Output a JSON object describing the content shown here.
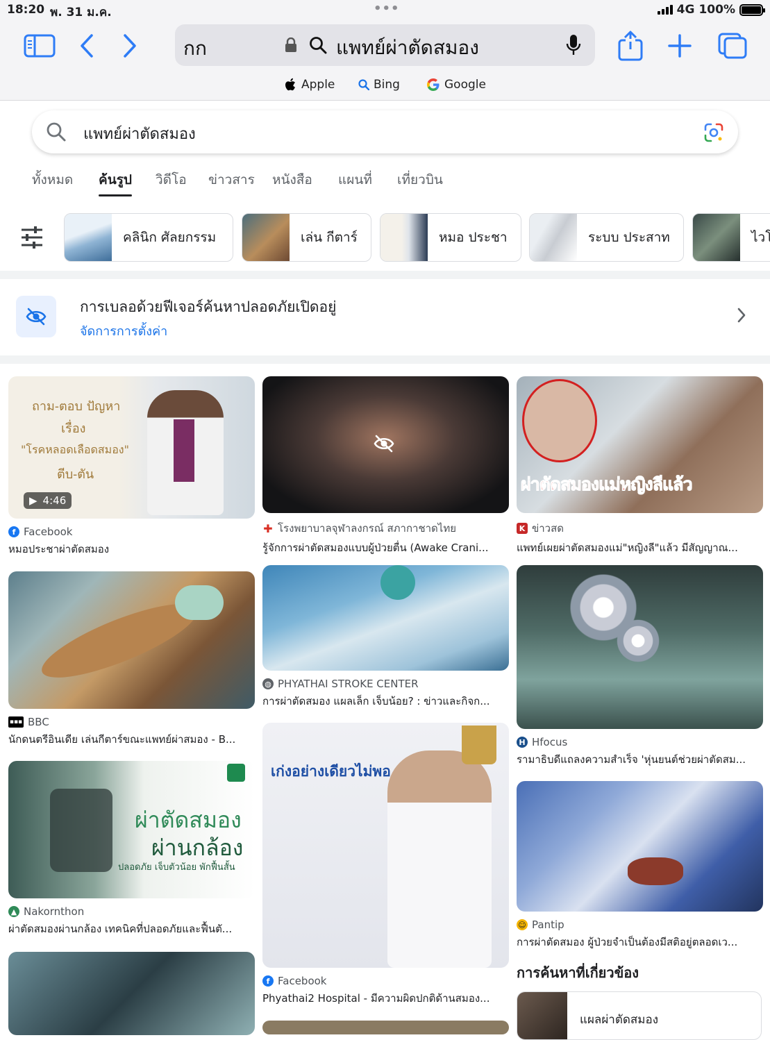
{
  "status_bar": {
    "time": "18:20",
    "date": "พ. 31 ม.ค.",
    "network": "4G",
    "battery": "100%"
  },
  "toolbar": {
    "text_size": "กก",
    "url": "แพทย์ผ่าตัดสมอง"
  },
  "bookmarks": [
    {
      "label": "Apple"
    },
    {
      "label": "Bing"
    },
    {
      "label": "Google"
    }
  ],
  "search": {
    "query": "แพทย์ผ่าตัดสมอง"
  },
  "tabs": [
    {
      "label": "ทั้งหมด"
    },
    {
      "label": "ค้นรูป",
      "active": true
    },
    {
      "label": "วิดีโอ"
    },
    {
      "label": "ข่าวสาร"
    },
    {
      "label": "หนังสือ"
    },
    {
      "label": "แผนที่"
    },
    {
      "label": "เที่ยวบิน"
    }
  ],
  "chips": [
    {
      "label": "คลินิก ศัลยกรรม"
    },
    {
      "label": "เล่น กีตาร์"
    },
    {
      "label": "หมอ ประชา"
    },
    {
      "label": "ระบบ ประสาท"
    },
    {
      "label": "ไวโอ"
    }
  ],
  "safe_search": {
    "title": "การเบลอด้วยฟีเจอร์ค้นหาปลอดภัยเปิดอยู่",
    "link": "จัดการการตั้งค่า"
  },
  "results": {
    "col1": [
      {
        "source": "Facebook",
        "title": "หมอประชาผ่าตัดสมอง",
        "duration": "4:46",
        "overlay": [
          "ถาม-ตอบ ปัญหา",
          "เรื่อง",
          "\"โรคหลอดเลือดสมอง\"",
          "ตีบ-ตัน"
        ]
      },
      {
        "source": "BBC",
        "title": "นักดนตรีอินเดีย เล่นกีตาร์ขณะแพทย์ผ่าสมอง - B..."
      },
      {
        "source": "Nakornthon",
        "title": "ผ่าตัดสมองผ่านกล้อง เทคนิคที่ปลอดภัยและฟื้นตั...",
        "overlay": [
          "ผ่าตัดสมอง",
          "ผ่านกล้อง",
          "ปลอดภัย เจ็บตัวน้อย พักฟื้นสั้น"
        ]
      }
    ],
    "col2": [
      {
        "source": "โรงพยาบาลจุฬาลงกรณ์ สภากาชาดไทย",
        "title": "รู้จักการผ่าตัดสมองแบบผู้ป่วยตื่น (Awake Crani..."
      },
      {
        "source": "PHYATHAI STROKE CENTER",
        "title": "การผ่าตัดสมอง แผลเล็ก เจ็บน้อย? : ข่าวและกิจก..."
      },
      {
        "source": "Facebook",
        "title": "Phyathai2 Hospital - มีความผิดปกติด้านสมอง...",
        "overlay": [
          "เก่งอย่างเดียวไม่พอ"
        ]
      }
    ],
    "col3": [
      {
        "source": "ข่าวสด",
        "title": "แพทย์เผยผ่าตัดสมองแม่\"หญิงลี\"แล้ว มีสัญญาณ...",
        "overlay": [
          "ผ่าตัดสมองแม่หญิงลีแล้ว"
        ]
      },
      {
        "source": "Hfocus",
        "title": "รามาธิบดีแถลงความสำเร็จ 'หุ่นยนต์ช่วยผ่าตัดสม..."
      },
      {
        "source": "Pantip",
        "title": "การผ่าตัดสมอง ผู้ป่วยจำเป็นต้องมีสติอยู่ตลอดเว..."
      }
    ]
  },
  "related": {
    "heading": "การค้นหาที่เกี่ยวข้อง",
    "items": [
      {
        "label": "แผลผ่าตัดสมอง"
      }
    ]
  },
  "colors": {
    "accent": "#2e7cf6",
    "link": "#1a73e8",
    "text": "#202124"
  }
}
